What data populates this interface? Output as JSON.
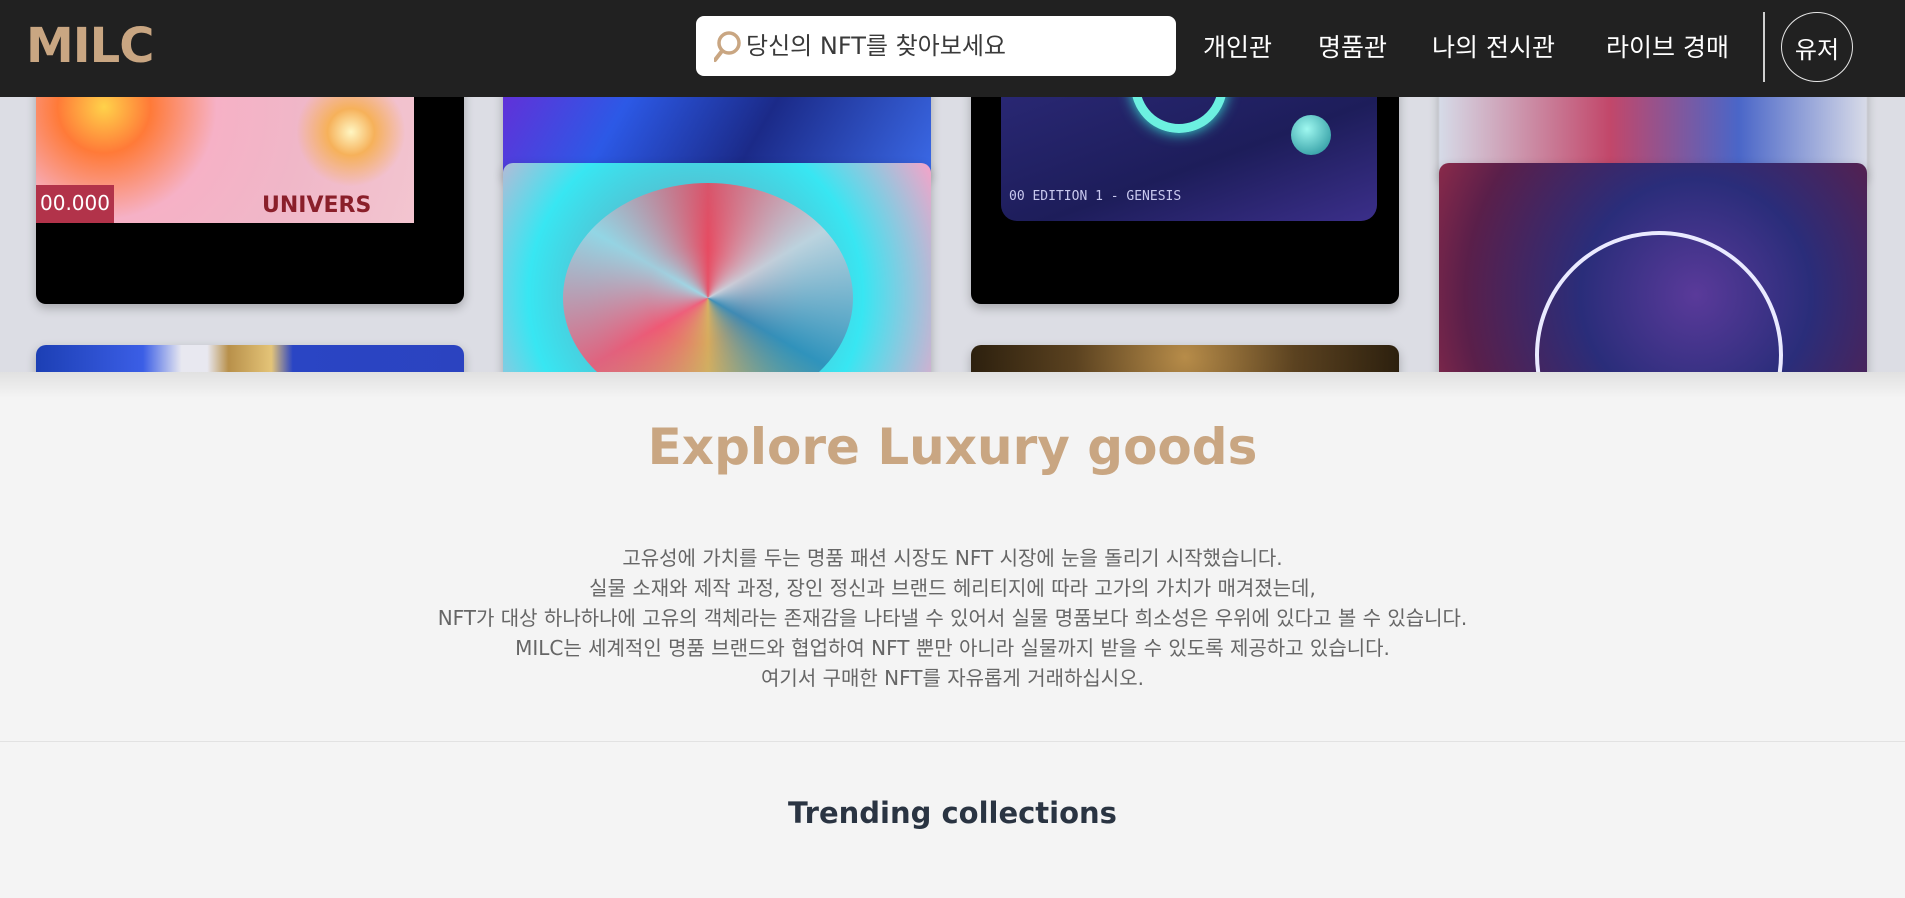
{
  "header": {
    "logo": "MILC",
    "search": {
      "placeholder": "당신의 NFT를 찾아보세요",
      "icon": "search-icon"
    },
    "nav": [
      "개인관",
      "명품관",
      "나의 전시관",
      "라이브 경매"
    ],
    "user_label": "유저"
  },
  "gallery": {
    "tile_texts": {
      "univers": "UNIVERS",
      "price": "00.000",
      "edition": "00 EDITION 1 - GENESIS"
    }
  },
  "intro": {
    "title": "Explore Luxury goods",
    "lines": [
      "고유성에 가치를 두는 명품 패션 시장도 NFT 시장에 눈을 돌리기 시작했습니다.",
      "실물 소재와 제작 과정, 장인 정신과 브랜드 헤리티지에 따라 고가의 가치가 매겨졌는데,",
      "NFT가 대상 하나하나에 고유의 객체라는 존재감을 나타낼 수 있어서 실물 명품보다 희소성은 우위에 있다고 볼 수 있습니다.",
      "MILC는 세계적인 명품 브랜드와 협업하여 NFT 뿐만 아니라 실물까지 받을 수 있도록 제공하고 있습니다.",
      "여기서 구매한 NFT를 자유롭게 거래하십시오."
    ]
  },
  "trending": {
    "title": "Trending collections"
  },
  "colors": {
    "accent": "#c9a682",
    "header_bg": "#212121",
    "page_bg": "#f4f4f4"
  }
}
